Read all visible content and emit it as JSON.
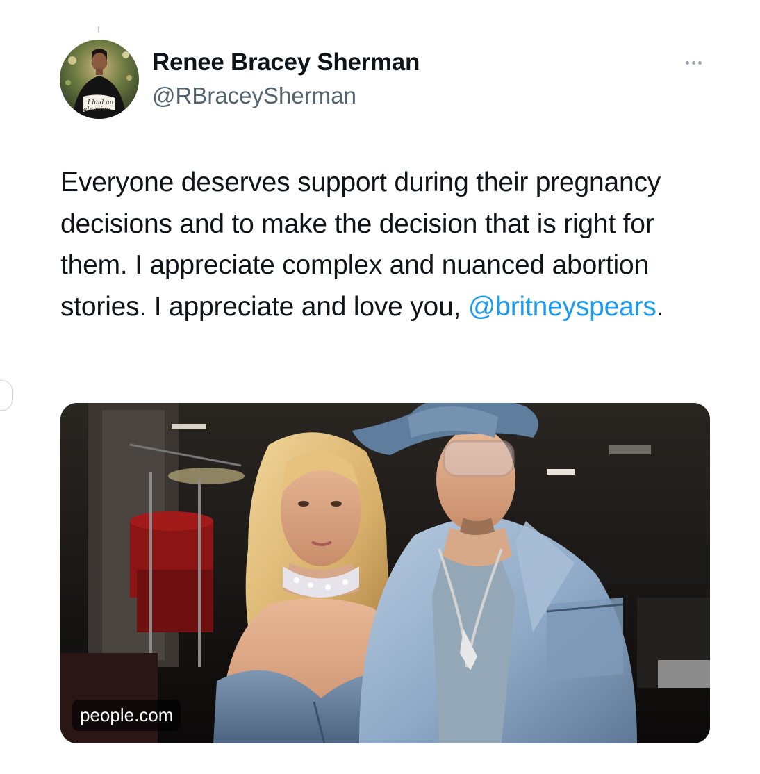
{
  "author": {
    "display_name": "Renee Bracey Sherman",
    "handle": "@RBraceySherman",
    "avatar_shirt_text_line1": "I had an",
    "avatar_shirt_text_line2": "abortion."
  },
  "tweet": {
    "text_before_mention": "Everyone deserves support during their pregnancy decisions and to make the decision that is right for them. I appreciate complex and nuanced abortion stories. I appreciate and love you, ",
    "mention": "@britneyspears",
    "text_after_mention": "."
  },
  "media": {
    "source_label": "people.com"
  },
  "icons": {
    "more": "more-horizontal-icon"
  },
  "colors": {
    "text_primary": "#0f1419",
    "text_secondary": "#536471",
    "link": "#1d9bf0"
  }
}
